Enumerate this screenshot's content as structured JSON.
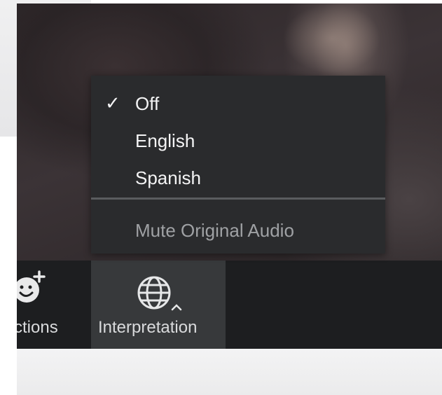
{
  "menu": {
    "items": [
      {
        "label": "Off",
        "checked": true
      },
      {
        "label": "English",
        "checked": false
      },
      {
        "label": "Spanish",
        "checked": false
      }
    ],
    "check_mark": "✓",
    "mute_label": "Mute Original Audio"
  },
  "toolbar": {
    "reactions_label": "ctions",
    "interpretation_label": "Interpretation"
  },
  "icons": {
    "globe": "globe-icon",
    "reactions": "smiley-plus-icon",
    "caret": "caret-up-icon"
  },
  "colors": {
    "toolbar_bg": "#1d1e20",
    "menu_bg": "#2a2b2d",
    "active_button_bg": "#37393b",
    "menu_text": "#f4f4f5",
    "disabled_text": "#9fa1a4"
  }
}
